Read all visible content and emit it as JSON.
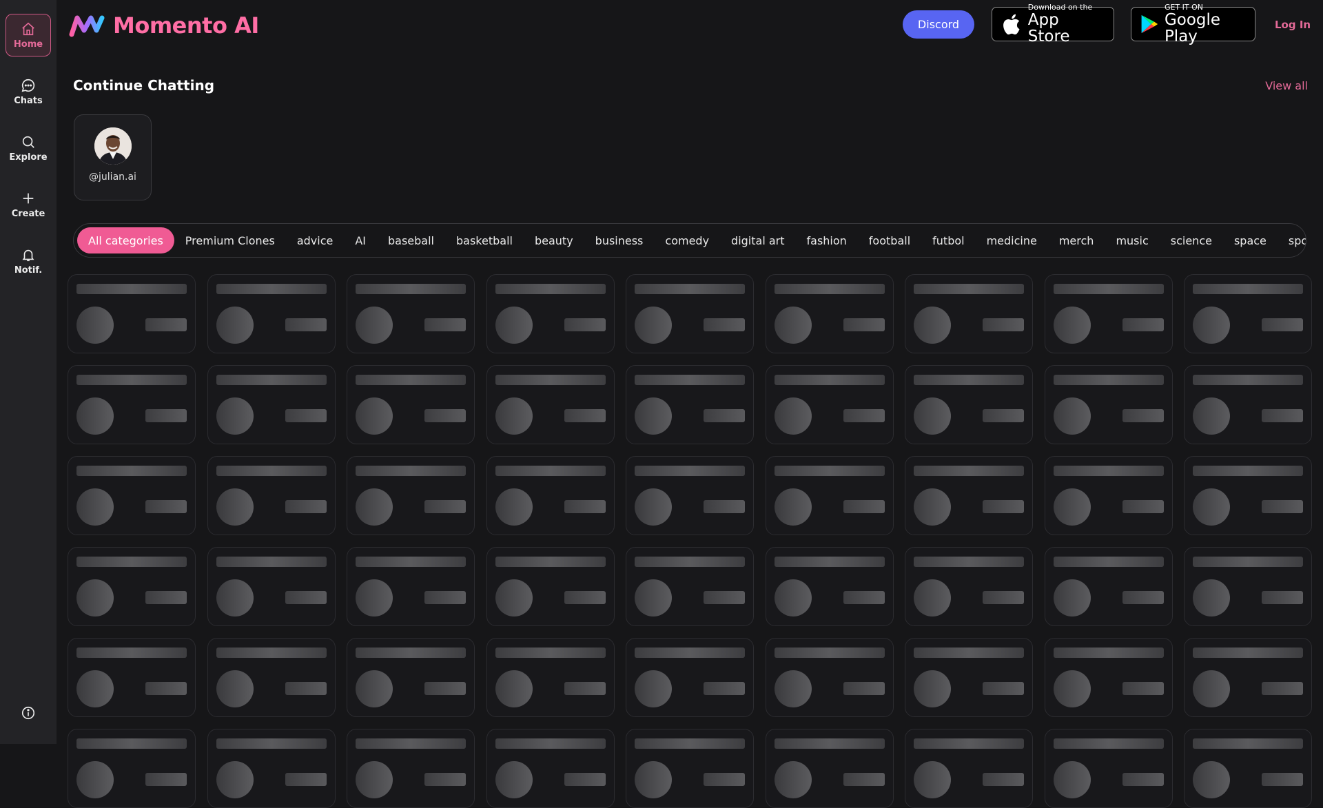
{
  "app": {
    "name": "Momento AI"
  },
  "sidebar": {
    "items": [
      {
        "label": "Home",
        "icon": "home-icon"
      },
      {
        "label": "Chats",
        "icon": "chat-bubble-icon"
      },
      {
        "label": "Explore",
        "icon": "search-icon"
      },
      {
        "label": "Create",
        "icon": "plus-icon"
      },
      {
        "label": "Notif.",
        "icon": "bell-icon"
      }
    ],
    "info_icon": "info-icon"
  },
  "header": {
    "discord_label": "Discord",
    "app_store": {
      "small": "Download on the",
      "big": "App Store"
    },
    "google_play": {
      "small": "GET IT ON",
      "big": "Google Play"
    },
    "login_label": "Log In"
  },
  "continue_chatting": {
    "title": "Continue Chatting",
    "view_all": "View all",
    "chats": [
      {
        "handle": "@julian.ai"
      }
    ]
  },
  "categories": {
    "selected": "All categories",
    "items": [
      "All categories",
      "Premium Clones",
      "advice",
      "AI",
      "baseball",
      "basketball",
      "beauty",
      "business",
      "comedy",
      "digital art",
      "fashion",
      "football",
      "futbol",
      "medicine",
      "merch",
      "music",
      "science",
      "space",
      "spo"
    ]
  },
  "colors": {
    "accent": "#f05b94",
    "discord": "#5865f2",
    "background": "#161618",
    "sidebar": "#232326"
  }
}
